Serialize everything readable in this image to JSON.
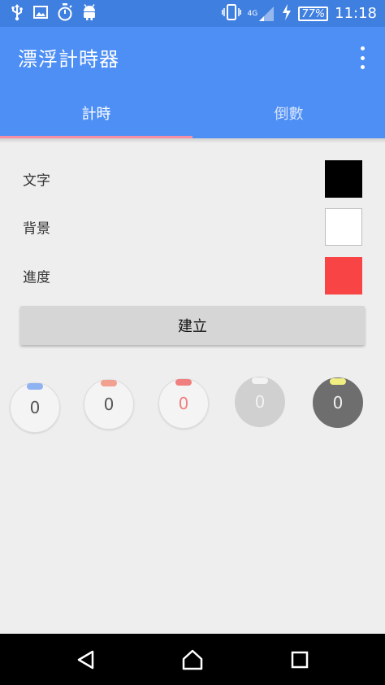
{
  "status_bar": {
    "network_label": "4G",
    "battery_percent": "77%",
    "time": "11:18",
    "icons_left": [
      "usb-icon",
      "image-icon",
      "stopwatch-icon",
      "android-icon"
    ],
    "icons_right": [
      "vibrate-icon",
      "signal-icon",
      "charging-icon",
      "battery-icon"
    ]
  },
  "app_bar": {
    "title": "漂浮計時器",
    "menu_icon": "more-vert-icon"
  },
  "tabs": [
    {
      "label": "計時",
      "active": true
    },
    {
      "label": "倒數",
      "active": false
    }
  ],
  "settings": [
    {
      "label": "文字",
      "color": "#000000"
    },
    {
      "label": "背景",
      "color": "#ffffff"
    },
    {
      "label": "進度",
      "color": "#f84444"
    }
  ],
  "create_button": {
    "label": "建立"
  },
  "presets": [
    {
      "value": "0",
      "background": "#f4f4f4",
      "border": "#dddddd",
      "text_color": "#555555",
      "handle": "#8fb3f2"
    },
    {
      "value": "0",
      "background": "#f4f4f4",
      "border": "#dddddd",
      "text_color": "#555555",
      "handle": "#f2a08f"
    },
    {
      "value": "0",
      "background": "#f4f4f4",
      "border": "#dddddd",
      "text_color": "#f07f7f",
      "handle": "#f07f7f"
    },
    {
      "value": "0",
      "background": "#d0d0d0",
      "border": "#d0d0d0",
      "text_color": "#f2f2f2",
      "handle": "#f2f2f2"
    },
    {
      "value": "0",
      "background": "#6e6e6e",
      "border": "#6e6e6e",
      "text_color": "#f2f2f2",
      "handle": "#f0ee82"
    }
  ],
  "nav_bar": {
    "icons": [
      "back-icon",
      "home-icon",
      "recents-icon"
    ]
  },
  "colors": {
    "status_bar": "#3f7fe0",
    "app_bar": "#4e8ff5",
    "tab_indicator": "#f48fa6",
    "page_background": "#eeeeee"
  }
}
